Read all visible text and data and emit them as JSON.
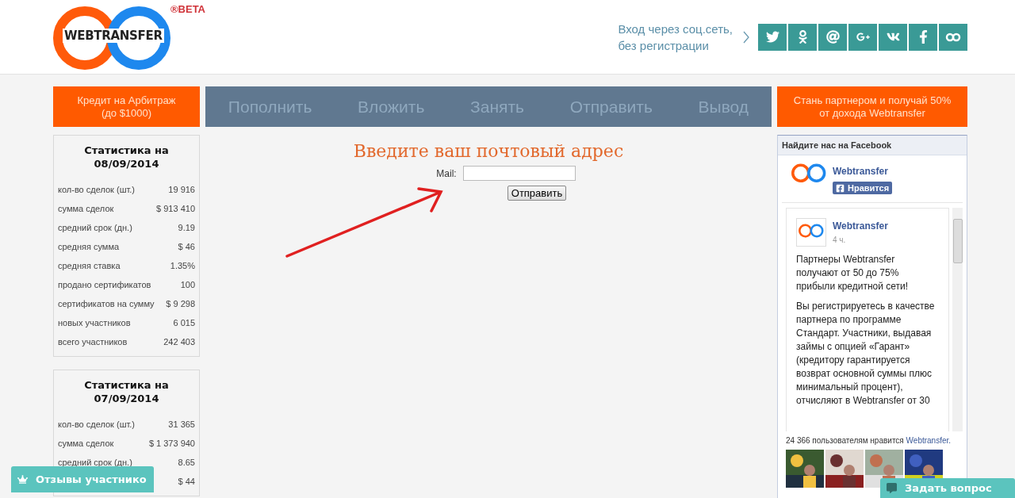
{
  "header": {
    "logo_text": "WEBTRANSFER",
    "beta": "®BETA",
    "social_login_text": [
      "Вход через соц.сеть,",
      "без регистрации"
    ]
  },
  "promo_left": [
    "Кредит на Арбитраж",
    "(до $1000)"
  ],
  "nav": [
    {
      "label": "Пополнить"
    },
    {
      "label": "Вложить"
    },
    {
      "label": "Занять"
    },
    {
      "label": "Отправить"
    },
    {
      "label": "Вывод"
    }
  ],
  "promo_right": [
    "Стань партнером и получай 50%",
    "от дохода Webtransfer"
  ],
  "stats": [
    {
      "title": [
        "Статистика на",
        "08/09/2014"
      ],
      "rows": [
        {
          "label": "кол-во сделок (шт.)",
          "value": "19 916"
        },
        {
          "label": "сумма сделок",
          "value": "$ 913 410"
        },
        {
          "label": "средний срок (дн.)",
          "value": "9.19"
        },
        {
          "label": "средняя сумма",
          "value": "$ 46"
        },
        {
          "label": "средняя ставка",
          "value": "1.35%"
        },
        {
          "label": "продано сертификатов",
          "value": "100"
        },
        {
          "label": "сертификатов на сумму",
          "value": "$ 9 298"
        },
        {
          "label": "новых участников",
          "value": "6 015"
        },
        {
          "label": "всего участников",
          "value": "242 403"
        }
      ]
    },
    {
      "title": [
        "Статистика на",
        "07/09/2014"
      ],
      "rows": [
        {
          "label": "кол-во сделок (шт.)",
          "value": "31 365"
        },
        {
          "label": "сумма сделок",
          "value": "$ 1 373 940"
        },
        {
          "label": "средний срок (дн.)",
          "value": "8.65"
        },
        {
          "value": "$ 44"
        }
      ]
    }
  ],
  "form": {
    "title": "Введите ваш почтовый адрес",
    "mail_label": "Mail:",
    "submit": "Отправить"
  },
  "facebook": {
    "header": "Найдите нас на Facebook",
    "page_name": "Webtransfer",
    "like": "Нравится",
    "post": {
      "author": "Webtransfer",
      "time": "4 ч.",
      "paragraphs": [
        "Партнеры Webtransfer получают от 50 до 75% прибыли кредитной сети!",
        "Вы регистрируетесь в качестве партнера по программе Стандарт. Участники, выдавая займы с опцией «Гарант» (кредитору гарантируется возврат основной суммы плюс минимальный процент), отчисляют в Webtransfer от 30"
      ]
    },
    "likes_text": "24 366 пользователям нравится ",
    "likes_link": "Webtransfer."
  },
  "feedback_tab": "Отзывы участнико",
  "ask_tab": "Задать вопрос"
}
